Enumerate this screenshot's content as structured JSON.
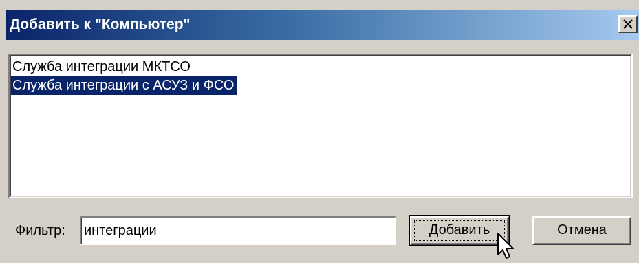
{
  "window": {
    "title": "Добавить к \"Компьютер\"",
    "close_glyph": "x"
  },
  "list": {
    "items": [
      {
        "label": "Служба интеграции МКТСО",
        "selected": false
      },
      {
        "label": "Служба интеграции с АСУЗ и ФСО",
        "selected": true
      }
    ]
  },
  "filter": {
    "label": "Фильтр:",
    "value": "интеграции"
  },
  "buttons": {
    "add_label": "Добавить",
    "cancel_label": "Отмена"
  },
  "colors": {
    "selection_bg": "#0a246a",
    "title_gradient_start": "#0a246a",
    "title_gradient_end": "#a6caf0",
    "face": "#d4d0c8"
  },
  "icons": {
    "close": "close-icon",
    "cursor": "mouse-pointer-icon"
  }
}
